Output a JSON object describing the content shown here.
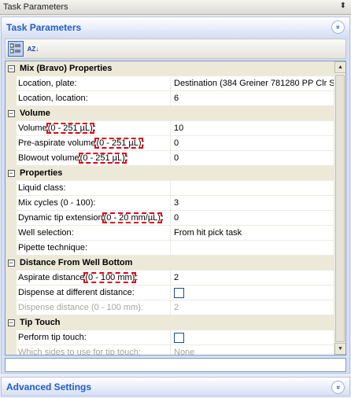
{
  "window": {
    "title": "Task Parameters",
    "pin_glyph": "⬍"
  },
  "panel": {
    "title": "Task Parameters",
    "collapse_glyph": "»"
  },
  "toolbar": {
    "categorized_icon": "categorized-icon",
    "alphabetical_label": "AZ↓"
  },
  "property_grid": {
    "categories": [
      {
        "name": "Mix (Bravo) Properties",
        "rows": [
          {
            "name": "Location, plate:",
            "value": "Destination  (384 Greiner 781280 PP Clr Sq"
          },
          {
            "name": "Location, location:",
            "value": "6"
          }
        ]
      },
      {
        "name": "Volume",
        "rows": [
          {
            "name": "Volume (0 - 251 µL):",
            "value": "10"
          },
          {
            "name": "Pre-aspirate volume (0 - 251 µL):",
            "value": "0"
          },
          {
            "name": "Blowout volume (0 - 251 µL):",
            "value": "0"
          }
        ]
      },
      {
        "name": "Properties",
        "rows": [
          {
            "name": "Liquid class:",
            "value": ""
          },
          {
            "name": "Mix cycles (0 - 100):",
            "value": "3"
          },
          {
            "name": "Dynamic tip extension (0 - 20 mm/µL):",
            "value": "0"
          },
          {
            "name": "Well selection:",
            "value": "From hit pick task"
          },
          {
            "name": "Pipette technique:",
            "value": ""
          }
        ]
      },
      {
        "name": "Distance From Well Bottom",
        "rows": [
          {
            "name": "Aspirate distance (0 - 100 mm):",
            "value": "2"
          },
          {
            "name": "Dispense at different distance:",
            "value": ""
          },
          {
            "name": "Dispense distance (0 - 100 mm):",
            "value": "2"
          }
        ]
      },
      {
        "name": "Tip Touch",
        "rows": [
          {
            "name": "Perform tip touch:",
            "value": ""
          },
          {
            "name": "Which sides to use for tip touch:",
            "value": "None"
          }
        ]
      }
    ],
    "expander_glyph": "−",
    "highlights": {
      "volume_a": "Volume ",
      "volume_b": "(0 - 251 µL)",
      "volume_c": ":",
      "preasp_a": "Pre-aspirate volume ",
      "preasp_b": "(0 - 251 µL)",
      "preasp_c": ":",
      "blowout_a": "Blowout volume ",
      "blowout_b": "(0 - 251 µL)",
      "blowout_c": ":",
      "dyn_a": "Dynamic tip extension ",
      "dyn_b": "(0 - 20 mm/µL)",
      "dyn_c": ":",
      "asp_a": "Aspirate distance ",
      "asp_b": "(0 - 100 mm)",
      "asp_c": ":"
    }
  },
  "scrollbar": {
    "up_glyph": "▲",
    "down_glyph": "▼"
  },
  "advanced": {
    "title": "Advanced Settings",
    "expand_glyph": "«"
  }
}
